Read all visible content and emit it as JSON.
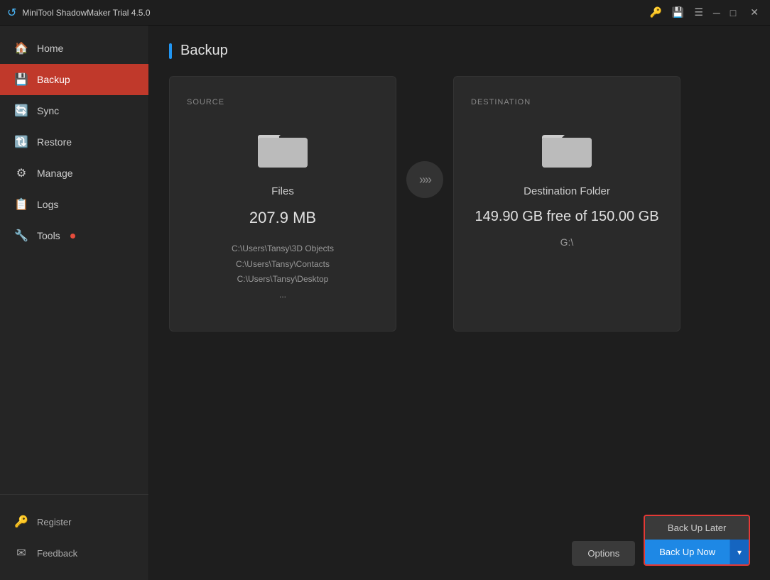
{
  "titleBar": {
    "appName": "MiniTool ShadowMaker Trial 4.5.0"
  },
  "sidebar": {
    "items": [
      {
        "id": "home",
        "label": "Home",
        "icon": "🏠",
        "active": false
      },
      {
        "id": "backup",
        "label": "Backup",
        "icon": "💾",
        "active": true
      },
      {
        "id": "sync",
        "label": "Sync",
        "icon": "🔄",
        "active": false
      },
      {
        "id": "restore",
        "label": "Restore",
        "icon": "⟳",
        "active": false
      },
      {
        "id": "manage",
        "label": "Manage",
        "icon": "⚙",
        "active": false
      },
      {
        "id": "logs",
        "label": "Logs",
        "icon": "📋",
        "active": false
      },
      {
        "id": "tools",
        "label": "Tools",
        "icon": "🔧",
        "active": false,
        "badge": true
      }
    ],
    "bottomItems": [
      {
        "id": "register",
        "label": "Register",
        "icon": "🔑"
      },
      {
        "id": "feedback",
        "label": "Feedback",
        "icon": "✉"
      }
    ]
  },
  "page": {
    "title": "Backup"
  },
  "sourceCard": {
    "label": "SOURCE",
    "type": "Files",
    "size": "207.9 MB",
    "paths": [
      "C:\\Users\\Tansy\\3D Objects",
      "C:\\Users\\Tansy\\Contacts",
      "C:\\Users\\Tansy\\Desktop",
      "..."
    ]
  },
  "destinationCard": {
    "label": "DESTINATION",
    "type": "Destination Folder",
    "free": "149.90 GB free of 150.00 GB",
    "drive": "G:\\"
  },
  "buttons": {
    "options": "Options",
    "backUpLater": "Back Up Later",
    "backUpNow": "Back Up Now"
  }
}
